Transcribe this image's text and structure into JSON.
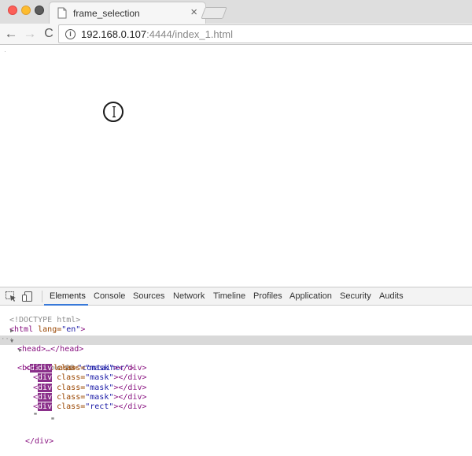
{
  "browser": {
    "tab_title": "frame_selection",
    "tab_close": "×",
    "url_host": "192.168.0.107",
    "url_rest": ":4444/index_1.html",
    "nav": {
      "back": "←",
      "forward": "→",
      "reload": "C"
    },
    "info": "i"
  },
  "devtools": {
    "tabs": [
      "Elements",
      "Console",
      "Sources",
      "Network",
      "Timeline",
      "Profiles",
      "Application",
      "Security",
      "Audits"
    ],
    "active_tab": "Elements",
    "dom": {
      "doctype": "<!DOCTYPE html>",
      "html_open": "<html",
      "html_attr": " lang=",
      "html_val": "\"en\"",
      "html_close": ">",
      "head": "<head>…</head>",
      "body_open": "<body>",
      "body_eq": " == ",
      "body_ref": "$0",
      "div_tag": "div",
      "lt": "<",
      "class_attr": " class=",
      "container_val": "\"container\"",
      "gt": ">",
      "close_div": "></div>",
      "mask_val": "\"mask\"",
      "rect_val": "\"rect\"",
      "text_node": "\"",
      "text_node_end": "\"",
      "div_close_line": "</div>"
    }
  }
}
